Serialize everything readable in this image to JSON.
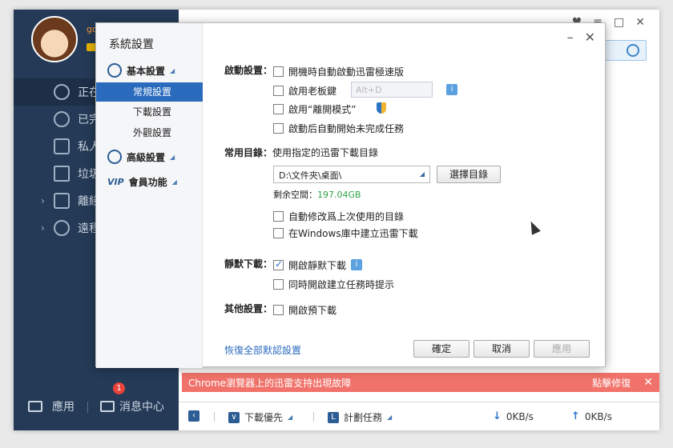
{
  "sidebar": {
    "username": "go",
    "items": [
      {
        "label": "正在"
      },
      {
        "label": "已完"
      },
      {
        "label": "私人"
      },
      {
        "label": "垃圾"
      },
      {
        "label": "離綫"
      },
      {
        "label": "遠程"
      }
    ],
    "bottom": {
      "apps_label": "應用",
      "messages_label": "消息中心",
      "message_count": "1"
    }
  },
  "dialog": {
    "title": "系統設置",
    "nav": {
      "basic": "基本設置",
      "basic_items": [
        "常規設置",
        "下載設置",
        "外觀設置"
      ],
      "advanced": "高級設置",
      "vip_tag": "VIP",
      "member": "會員功能"
    },
    "startup": {
      "label": "啟動設置：",
      "options": [
        "開機時自動啟動迅雷極速版",
        "啟用老板鍵",
        "啟用“離開模式”",
        "啟動后自動開始未完成任務"
      ],
      "hotkey_placeholder": "Alt+D"
    },
    "directory": {
      "label": "常用目錄：",
      "desc": "使用指定的迅雷下載目錄",
      "path": "D:\\文件夾\\桌面\\",
      "choose_button": "選擇目錄",
      "free_space_label": "剩余空間：",
      "free_space_value": "197.04GB",
      "options": [
        "自動修改爲上次使用的目錄",
        "在Windows庫中建立迅雷下載"
      ]
    },
    "silent": {
      "label": "靜默下載：",
      "options": [
        "開啟靜默下載",
        "同時開啟建立任務時提示"
      ]
    },
    "other": {
      "label": "其他設置：",
      "options": [
        "開啟預下載"
      ]
    },
    "reset_link": "恢復全部默認設置",
    "buttons": {
      "ok": "確定",
      "cancel": "取消",
      "apply": "應用"
    }
  },
  "notice": {
    "text": "Chrome瀏覽器上的迅雷支持出現故障",
    "action": "點擊修復"
  },
  "toolbar": {
    "priority": "下載優先",
    "schedule": "計劃任務",
    "down_speed": "0KB/s",
    "up_speed": "0KB/s"
  }
}
